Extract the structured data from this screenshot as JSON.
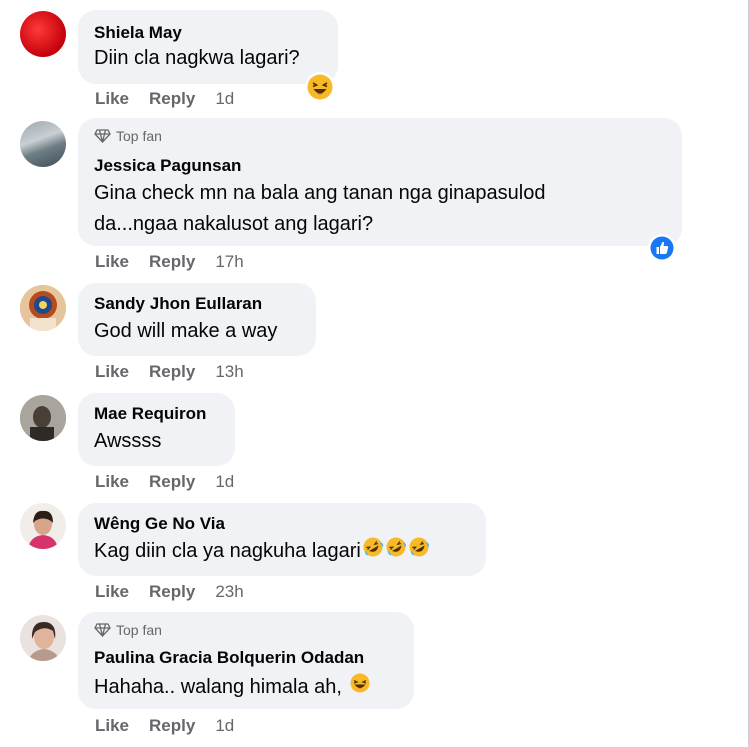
{
  "actions": {
    "like": "Like",
    "reply": "Reply"
  },
  "comments": [
    {
      "name": "Shiela May",
      "text": "Diin cla nagkwa lagari?",
      "time": "1d",
      "reaction": "haha-icon"
    },
    {
      "badge": "Top fan",
      "name": "Jessica Pagunsan",
      "line1": "Gina check mn na bala ang tanan nga ginapasulod",
      "line2": "da...ngaa nakalusot ang lagari?",
      "time": "17h",
      "reaction": "like-icon"
    },
    {
      "name": "Sandy Jhon Eullaran",
      "text": "God will make a way",
      "time": "13h"
    },
    {
      "name": "Mae Requiron",
      "text": "Awssss",
      "time": "1d"
    },
    {
      "name": "Wêng Ge No Via",
      "text": "Kag diin cla ya nagkuha lagari",
      "time": "23h",
      "emojis": [
        "rofl-emoji",
        "rofl-emoji",
        "rofl-emoji"
      ]
    },
    {
      "badge": "Top fan",
      "name": "Paulina Gracia Bolquerin Odadan",
      "text": "Hahaha.. walang himala ah, ",
      "time": "1d",
      "emojis": [
        "laughing-emoji"
      ]
    }
  ],
  "colors": {
    "bubble": "#f0f2f5",
    "secondary_text": "#65676b",
    "like_blue": "#1877f2"
  }
}
